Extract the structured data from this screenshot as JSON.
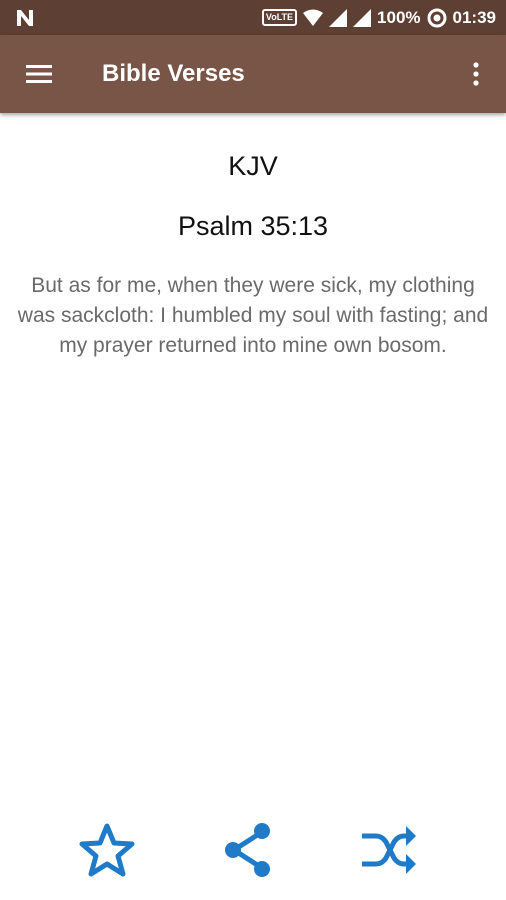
{
  "status_bar": {
    "volte_label": "VoLTE",
    "battery": "100%",
    "time": "01:39"
  },
  "app_bar": {
    "title": "Bible Verses",
    "menu_icon": "hamburger-menu-icon",
    "overflow_icon": "more-vert-icon"
  },
  "verse": {
    "version": "KJV",
    "reference": "Psalm 35:13",
    "text": "But as for me, when they were sick, my clothing was sackcloth: I humbled my soul with fasting; and my prayer returned into mine own bosom."
  },
  "actions": {
    "favorite_icon": "star-outline-icon",
    "share_icon": "share-icon",
    "shuffle_icon": "shuffle-icon"
  },
  "colors": {
    "status_bar": "#5d4033",
    "app_bar": "#795548",
    "action_icons": "#1f7ac7",
    "verse_text": "#6a6a6a"
  }
}
